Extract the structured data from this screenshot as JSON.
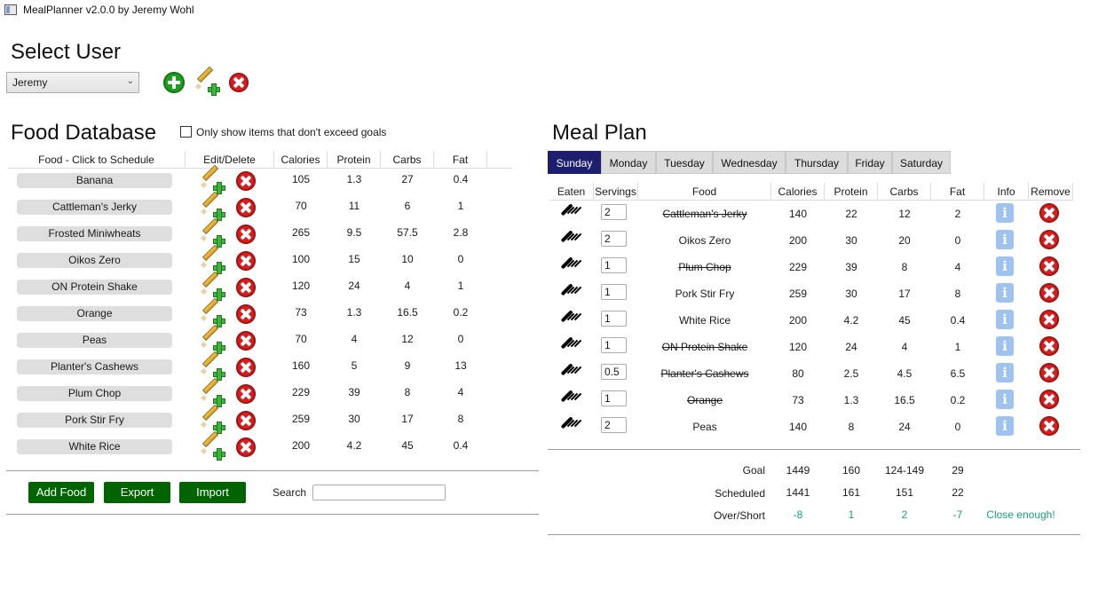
{
  "window": {
    "title": "MealPlanner v2.0.0 by Jeremy Wohl"
  },
  "select_user": {
    "heading": "Select User",
    "selected_user": "Jeremy"
  },
  "food_db": {
    "heading": "Food Database",
    "filter_label": "Only show items that don't exceed goals",
    "filter_checked": false,
    "columns": [
      "Food - Click to Schedule",
      "Edit/Delete",
      "Calories",
      "Protein",
      "Carbs",
      "Fat"
    ],
    "rows": [
      {
        "name": "Banana",
        "calories": "105",
        "protein": "1.3",
        "carbs": "27",
        "fat": "0.4"
      },
      {
        "name": "Cattleman's Jerky",
        "calories": "70",
        "protein": "11",
        "carbs": "6",
        "fat": "1"
      },
      {
        "name": "Frosted Miniwheats",
        "calories": "265",
        "protein": "9.5",
        "carbs": "57.5",
        "fat": "2.8"
      },
      {
        "name": "Oikos Zero",
        "calories": "100",
        "protein": "15",
        "carbs": "10",
        "fat": "0"
      },
      {
        "name": "ON Protein Shake",
        "calories": "120",
        "protein": "24",
        "carbs": "4",
        "fat": "1"
      },
      {
        "name": "Orange",
        "calories": "73",
        "protein": "1.3",
        "carbs": "16.5",
        "fat": "0.2"
      },
      {
        "name": "Peas",
        "calories": "70",
        "protein": "4",
        "carbs": "12",
        "fat": "0"
      },
      {
        "name": "Planter's Cashews",
        "calories": "160",
        "protein": "5",
        "carbs": "9",
        "fat": "13"
      },
      {
        "name": "Plum Chop",
        "calories": "229",
        "protein": "39",
        "carbs": "8",
        "fat": "4"
      },
      {
        "name": "Pork Stir Fry",
        "calories": "259",
        "protein": "30",
        "carbs": "17",
        "fat": "8"
      },
      {
        "name": "White Rice",
        "calories": "200",
        "protein": "4.2",
        "carbs": "45",
        "fat": "0.4"
      }
    ],
    "buttons": {
      "add_food": "Add Food",
      "export": "Export",
      "import": "Import"
    },
    "search_label": "Search",
    "search_value": ""
  },
  "meal_plan": {
    "heading": "Meal Plan",
    "tabs": [
      "Sunday",
      "Monday",
      "Tuesday",
      "Wednesday",
      "Thursday",
      "Friday",
      "Saturday"
    ],
    "active_tab": "Sunday",
    "columns": [
      "Eaten",
      "Servings",
      "Food",
      "Calories",
      "Protein",
      "Carbs",
      "Fat",
      "Info",
      "Remove"
    ],
    "rows": [
      {
        "servings": "2",
        "food": "Cattleman's Jerky",
        "eaten": true,
        "calories": "140",
        "protein": "22",
        "carbs": "12",
        "fat": "2"
      },
      {
        "servings": "2",
        "food": "Oikos Zero",
        "eaten": false,
        "calories": "200",
        "protein": "30",
        "carbs": "20",
        "fat": "0"
      },
      {
        "servings": "1",
        "food": "Plum Chop",
        "eaten": true,
        "calories": "229",
        "protein": "39",
        "carbs": "8",
        "fat": "4"
      },
      {
        "servings": "1",
        "food": "Pork Stir Fry",
        "eaten": false,
        "calories": "259",
        "protein": "30",
        "carbs": "17",
        "fat": "8"
      },
      {
        "servings": "1",
        "food": "White Rice",
        "eaten": false,
        "calories": "200",
        "protein": "4.2",
        "carbs": "45",
        "fat": "0.4"
      },
      {
        "servings": "1",
        "food": "ON Protein Shake",
        "eaten": true,
        "calories": "120",
        "protein": "24",
        "carbs": "4",
        "fat": "1"
      },
      {
        "servings": "0.5",
        "food": "Planter's Cashews",
        "eaten": true,
        "calories": "80",
        "protein": "2.5",
        "carbs": "4.5",
        "fat": "6.5"
      },
      {
        "servings": "1",
        "food": "Orange",
        "eaten": true,
        "calories": "73",
        "protein": "1.3",
        "carbs": "16.5",
        "fat": "0.2"
      },
      {
        "servings": "2",
        "food": "Peas",
        "eaten": false,
        "calories": "140",
        "protein": "8",
        "carbs": "24",
        "fat": "0"
      }
    ],
    "summary": {
      "goal": {
        "label": "Goal",
        "calories": "1449",
        "protein": "160",
        "carbs": "124-149",
        "fat": "29"
      },
      "scheduled": {
        "label": "Scheduled",
        "calories": "1441",
        "protein": "161",
        "carbs": "151",
        "fat": "22"
      },
      "over_short": {
        "label": "Over/Short",
        "calories": "-8",
        "protein": "1",
        "carbs": "2",
        "fat": "-7",
        "status": "Close enough!"
      }
    }
  },
  "colors": {
    "active_tab": "#1d1f6e",
    "action_button": "#006400",
    "good": "#1aa07a",
    "delete": "#d81e1e"
  }
}
